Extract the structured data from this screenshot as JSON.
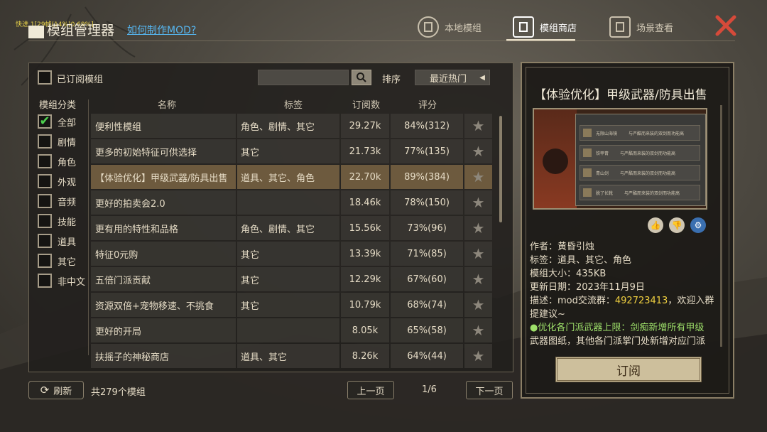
{
  "overlay": {
    "fps": "快进 1[29帧(14%)0.69%]"
  },
  "header": {
    "title": "模组管理器",
    "howto_link": "如何制作MOD?",
    "tabs": [
      {
        "label": "本地模组",
        "icon": "local-mods-icon"
      },
      {
        "label": "模组商店",
        "icon": "mod-store-icon"
      },
      {
        "label": "场景查看",
        "icon": "scene-view-icon"
      }
    ],
    "active_tab": "模组商店",
    "close_icon": "close-x-icon"
  },
  "filters": {
    "subscribed_label": "已订阅模组",
    "sort_label": "排序",
    "sort_value": "最近热门",
    "search_placeholder": ""
  },
  "categories": {
    "title": "模组分类",
    "items": [
      {
        "label": "全部",
        "checked": true
      },
      {
        "label": "剧情"
      },
      {
        "label": "角色"
      },
      {
        "label": "外观"
      },
      {
        "label": "音频"
      },
      {
        "label": "技能"
      },
      {
        "label": "道具"
      },
      {
        "label": "其它"
      },
      {
        "label": "非中文"
      }
    ]
  },
  "table": {
    "headers": [
      "名称",
      "标签",
      "订阅数",
      "评分"
    ],
    "rows": [
      [
        "便利性模组",
        "角色、剧情、其它",
        "29.27k",
        "84%(312)"
      ],
      [
        "更多的初始特征可供选择",
        "其它",
        "21.73k",
        "77%(135)"
      ],
      [
        "【体验优化】甲级武器/防具出售",
        "道具、其它、角色",
        "22.70k",
        "89%(384)"
      ],
      [
        "更好的拍卖会2.0",
        "",
        "18.46k",
        "78%(150)"
      ],
      [
        "更有用的特性和品格",
        "角色、剧情、其它",
        "15.56k",
        "73%(96)"
      ],
      [
        "特征0元购",
        "其它",
        "13.39k",
        "71%(85)"
      ],
      [
        "五倍门派贡献",
        "其它",
        "12.29k",
        "67%(60)"
      ],
      [
        "资源双倍+宠物移速、不挑食",
        "其它",
        "10.79k",
        "68%(74)"
      ],
      [
        "更好的开局",
        "",
        "8.05k",
        "65%(58)"
      ],
      [
        "扶摇子的神秘商店",
        "道具、其它",
        "8.26k",
        "64%(44)"
      ]
    ],
    "selected_index": 2
  },
  "footer": {
    "refresh_label": "刷新",
    "total": "共279个模组",
    "prev": "上一页",
    "page": "1/6",
    "next": "下一页"
  },
  "detail": {
    "title": "【体验优化】甲级武器/防具出售",
    "author": "作者：黄昏引烛",
    "tags": "标签：道具、其它、角色",
    "size": "模组大小：435KB",
    "date": "更新日期：2023年11月9日",
    "desc_prefix": "描述：mod交流群：",
    "desc_group": "492723413",
    "desc_suffix": "，欢迎入群",
    "desc_line2": "提建议~",
    "desc_line3": "●优化各门派武器上限：剑痴新增所有甲级",
    "desc_line4": "武器图纸，其他各门派掌门处新增对应门派",
    "subscribe_label": "订阅",
    "preview_rows": [
      "无限山海镜",
      "铁甲胄",
      "青山剑",
      "脱了长靴"
    ],
    "preview_desc": "与严酷而来装的双剑而功能高",
    "vote_icons": [
      "thumbs-up-icon",
      "thumbs-down-icon",
      "steam-icon"
    ]
  }
}
